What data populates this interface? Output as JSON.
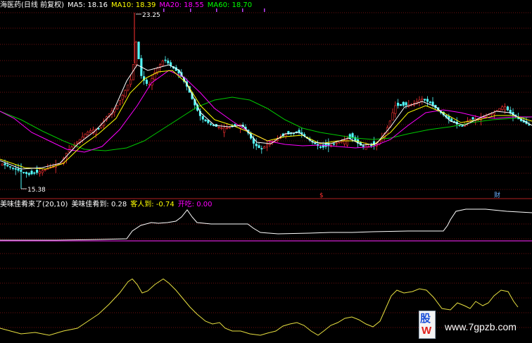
{
  "header_top": {
    "title": "海医药(日线 前复权)",
    "ma5": "MA5: 18.16",
    "ma10": "MA10: 18.39",
    "ma20": "MA20: 18.55",
    "ma60": "MA60: 18.70"
  },
  "price_labels": {
    "high": "23.25",
    "low": "15.38"
  },
  "markers": {
    "m1": "$",
    "m2": "财"
  },
  "header_bottom": {
    "name": "美味佳肴来了(20,10)",
    "v1": "美味佳肴到: 0.28",
    "v2": "客人到: -0.74",
    "v3": "开吃: 0.00"
  },
  "watermark": {
    "top": "股",
    "bottom": "W",
    "url": "www.7gpzb.com"
  },
  "colors": {
    "up": "#ff3232",
    "down": "#54ffff",
    "ma5": "#ffffff",
    "ma10": "#ffff00",
    "ma20": "#ff00ff",
    "ma60": "#00c800",
    "grid": "#701010"
  }
}
